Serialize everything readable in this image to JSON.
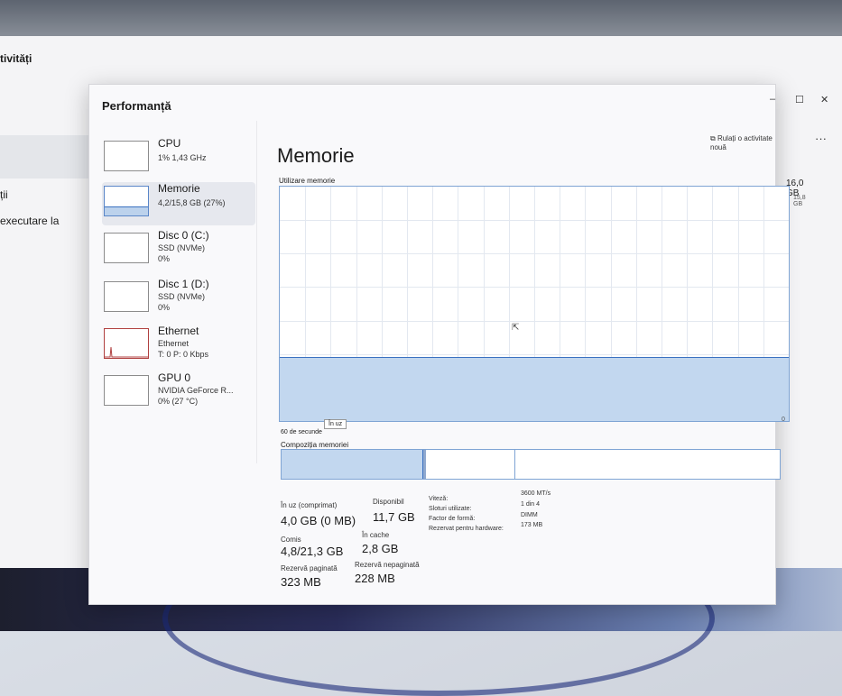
{
  "background_window": {
    "title": "tivități",
    "items": [
      "ții",
      "executare la"
    ]
  },
  "window": {
    "title": "Performanță",
    "controls": {
      "minimize": "–",
      "maximize": "☐",
      "close": "✕"
    }
  },
  "sidebar": {
    "items": [
      {
        "name": "CPU",
        "sub1": "1% 1,43 GHz",
        "sub2": "",
        "sub3": ""
      },
      {
        "name": "Memorie",
        "sub1": "4,2/15,8 GB (27%)",
        "sub2": "",
        "sub3": ""
      },
      {
        "name": "Disc 0 (C:)",
        "sub1": "SSD (NVMe)",
        "sub2": "0%",
        "sub3": ""
      },
      {
        "name": "Disc 1 (D:)",
        "sub1": "SSD (NVMe)",
        "sub2": "0%",
        "sub3": ""
      },
      {
        "name": "Ethernet",
        "sub1": "Ethernet",
        "sub2": "T: 0 P: 0 Kbps",
        "sub3": ""
      },
      {
        "name": "GPU 0",
        "sub1": "NVIDIA GeForce R...",
        "sub2": "0% (27 °C)",
        "sub3": ""
      }
    ],
    "memory_usage_fraction": 0.27
  },
  "header": {
    "run_task_label": "Rulați o activitate nouă",
    "more_label": "···"
  },
  "memory": {
    "title": "Memorie",
    "total": "16,0 GB",
    "usage_label": "Utilizare memorie",
    "max_label": "15,8 GB",
    "time_label": "60 de secunde",
    "zero_label": "0",
    "tooltip": "În uz",
    "graph_fill_fraction": 0.27,
    "composition_label": "Compoziția memoriei",
    "composition": {
      "in_use_fraction": 0.285,
      "modified_fraction": 0.005,
      "standby_fraction": 0.18
    }
  },
  "stats": {
    "in_use_label": "În uz (comprimat)",
    "in_use_value": "4,0 GB (0 MB)",
    "available_label": "Disponibil",
    "available_value": "11,7 GB",
    "committed_label": "Comis",
    "committed_value": "4,8/21,3 GB",
    "cached_label": "În cache",
    "cached_value": "2,8 GB",
    "paged_label": "Rezervă paginată",
    "paged_value": "323 MB",
    "nonpaged_label": "Rezervă nepaginată",
    "nonpaged_value": "228 MB"
  },
  "properties": [
    {
      "label": "Viteză:",
      "value": "3600 MT/s"
    },
    {
      "label": "Sloturi utilizate:",
      "value": "1 din 4"
    },
    {
      "label": "Factor de formă:",
      "value": "DIMM"
    },
    {
      "label": "Rezervat pentru hardware:",
      "value": "173 MB"
    }
  ],
  "icons": {
    "run_task": "run-task-icon",
    "cursor": "mouse-cursor-icon"
  }
}
